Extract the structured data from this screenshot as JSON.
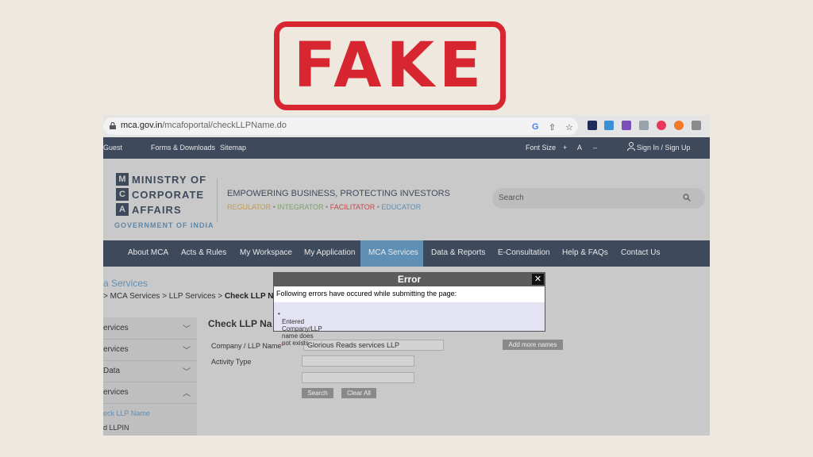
{
  "stamp": {
    "text": "FAKE",
    "color": "#d7262f"
  },
  "browser": {
    "url_host": "mca.gov.in",
    "url_path": "/mcafoportal/checkLLPName.do",
    "icons": [
      "lock-icon",
      "google-icon",
      "share-icon",
      "star-icon"
    ],
    "extensions": [
      "#1f2d5a",
      "#3a8fd6",
      "#7b4fb8",
      "#9aa3ad",
      "#e9365a",
      "#f07a2a",
      "#8a8a8a"
    ]
  },
  "topnav": {
    "guest": "Guest",
    "forms": "Forms & Downloads",
    "sitemap": "Sitemap",
    "font_size": "Font Size",
    "plus": "+",
    "a": "A",
    "minus": "–",
    "signin": "Sign In / Sign Up"
  },
  "header": {
    "logo_letters": [
      "M",
      "C",
      "A"
    ],
    "logo_lines": [
      "MINISTRY OF",
      "CORPORATE",
      "AFFAIRS"
    ],
    "gov": "GOVERNMENT OF INDIA",
    "tagline": "EMPOWERING BUSINESS, PROTECTING INVESTORS",
    "roles": [
      {
        "text": "REGULATOR",
        "color": "#c79a4a"
      },
      {
        "text": "INTEGRATOR",
        "color": "#7aa36a"
      },
      {
        "text": "FACILITATOR",
        "color": "#c3484c"
      },
      {
        "text": "EDUCATOR",
        "color": "#5f8fb4"
      }
    ],
    "search_placeholder": "Search"
  },
  "mainnav": {
    "items": [
      "About MCA",
      "Acts & Rules",
      "My Workspace",
      "My Application",
      "MCA Services",
      "Data & Reports",
      "E-Consultation",
      "Help & FAQs",
      "Contact Us"
    ],
    "active": "MCA Services"
  },
  "page": {
    "section_title": "a Services",
    "crumb_prefix": "> MCA Services > LLP Services > ",
    "crumb_current": "Check LLP N",
    "heading": "Check LLP Na"
  },
  "sidebar": {
    "items": [
      "ervices",
      "ervices",
      "Data",
      "ervices"
    ],
    "sub_active": "eck LLP Name",
    "sub_other": "d LLPIN"
  },
  "form": {
    "company_label": "Company / LLP Name",
    "required_mark": "*",
    "company_value": "Glorious Reads services LLP",
    "activity_label": "Activity Type",
    "add_more": "Add more names",
    "search_btn": "Search",
    "clear_btn": "Clear All"
  },
  "dialog": {
    "title": "Error",
    "close": "✕",
    "message": "Following errors have occured while submitting the page:",
    "error": "Entered Company/LLP name does not exists."
  }
}
